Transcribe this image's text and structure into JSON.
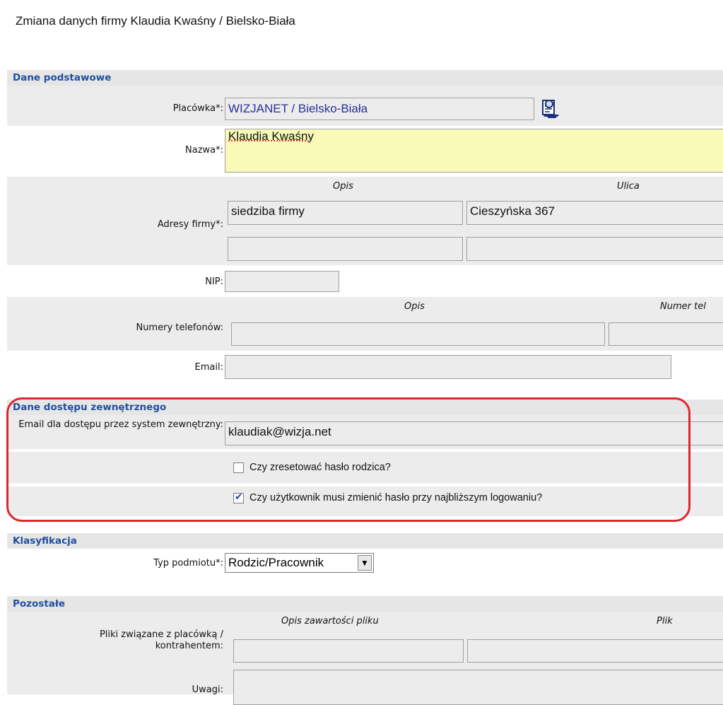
{
  "page": {
    "title": "Zmiana danych firmy Klaudia Kwaśny / Bielsko-Biała"
  },
  "sections": {
    "basic": "Dane podstawowe",
    "external": "Dane dostępu zewnętrznego",
    "classification": "Klasyfikacja",
    "other": "Pozostałe"
  },
  "fields": {
    "placowka": {
      "label": "Placówka*:",
      "value": "WIZJANET / Bielsko-Biała"
    },
    "nazwa": {
      "label": "Nazwa*:",
      "value": "Klaudia Kwaśny"
    },
    "adresy": {
      "label": "Adresy firmy*:",
      "col_opis": "Opis",
      "col_ulica": "Ulica",
      "rows": [
        {
          "opis": "siedziba firmy",
          "ulica": "Cieszyńska 367"
        },
        {
          "opis": "",
          "ulica": ""
        }
      ]
    },
    "nip": {
      "label": "NIP:",
      "value": ""
    },
    "telefony": {
      "label": "Numery telefonów:",
      "col_opis": "Opis",
      "col_numer": "Numer tel"
    },
    "email": {
      "label": "Email:",
      "value": ""
    },
    "ext_email": {
      "label": "Email dla dostępu przez system zewnętrzny:",
      "value": "klaudiak@wizja.net"
    },
    "reset_password": {
      "label": "Czy zresetować hasło rodzica?",
      "checked": false
    },
    "force_change": {
      "label": "Czy użytkownik musi zmienić hasło przy najbliższym logowaniu?",
      "checked": true
    },
    "typ_podmiotu": {
      "label": "Typ podmiotu*:",
      "value": "Rodzic/Pracownik"
    },
    "pliki": {
      "label": "Pliki związane z placówką / kontrahentem:",
      "col_opis": "Opis zawartości pliku",
      "col_plik": "Plik"
    },
    "uwagi": {
      "label": "Uwagi:"
    }
  },
  "icons": {
    "picker": "person-search-icon",
    "dropdown": "chevron-down-icon"
  },
  "colors": {
    "section_text": "#1f4f9f",
    "highlight": "#e0262f",
    "name_field": "#fafab8"
  }
}
